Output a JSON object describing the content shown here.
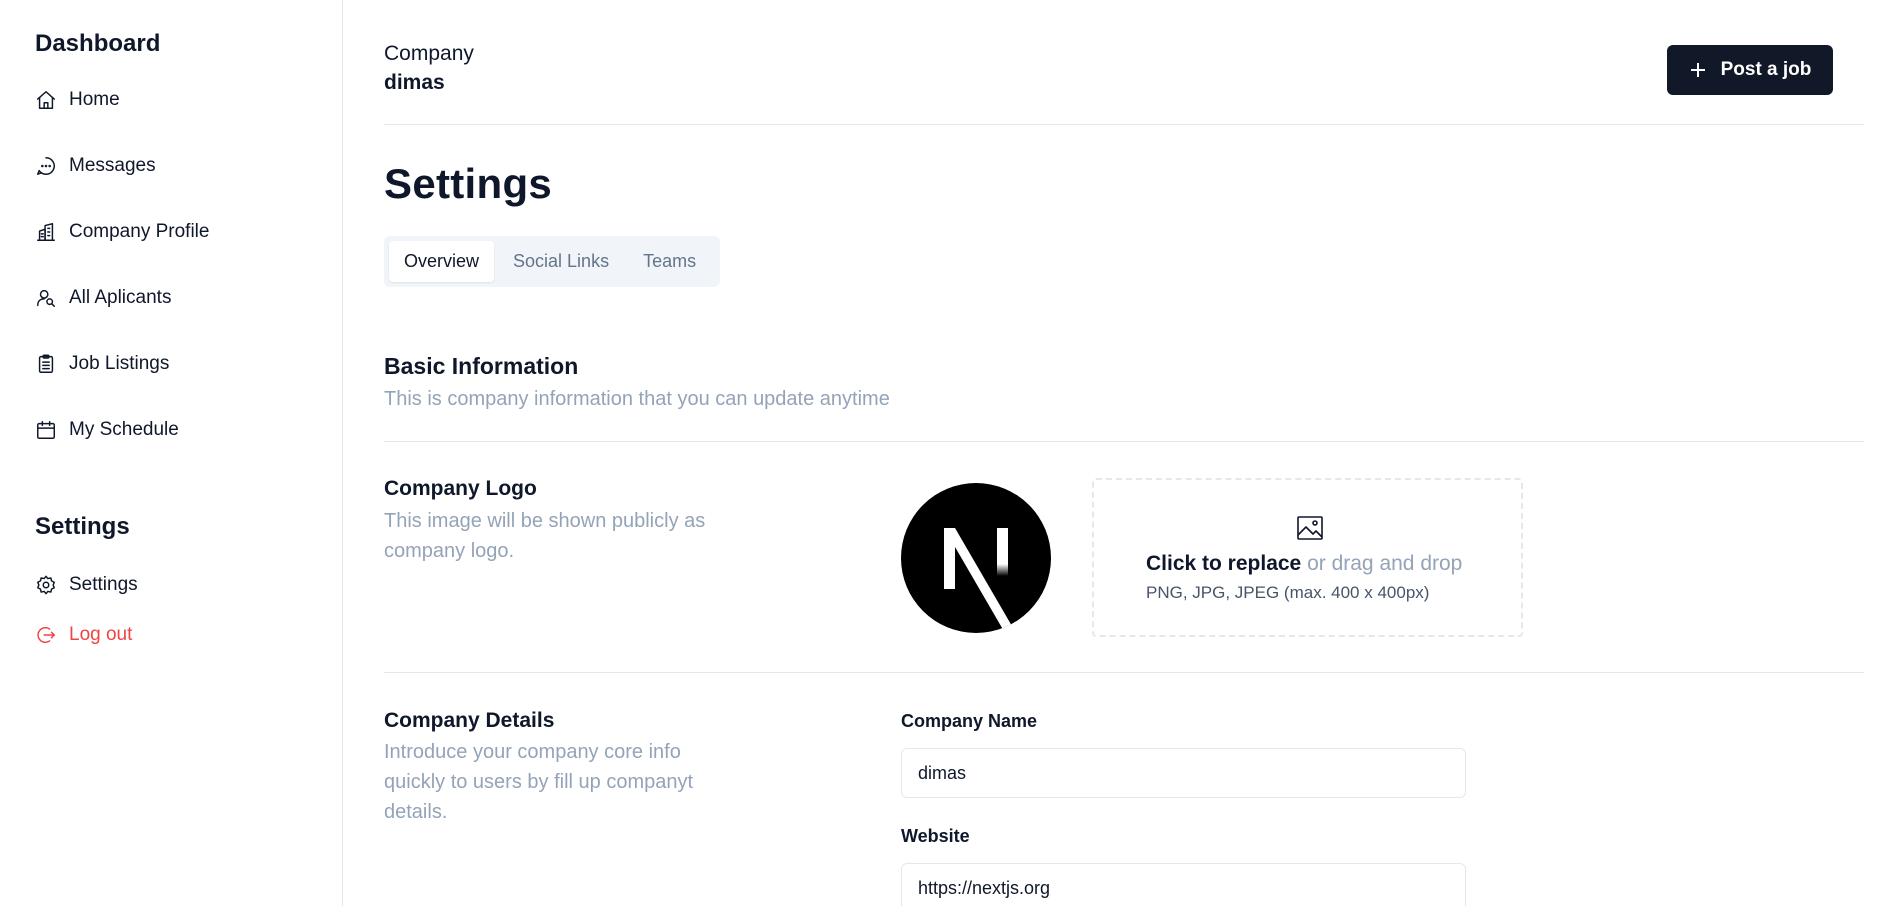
{
  "sidebar": {
    "dashboard_heading": "Dashboard",
    "items": [
      {
        "label": "Home",
        "icon": "home-icon"
      },
      {
        "label": "Messages",
        "icon": "chat-icon"
      },
      {
        "label": "Company Profile",
        "icon": "building-icon"
      },
      {
        "label": "All Aplicants",
        "icon": "users-icon"
      },
      {
        "label": "Job Listings",
        "icon": "clipboard-icon"
      },
      {
        "label": "My Schedule",
        "icon": "calendar-icon"
      }
    ],
    "settings_heading": "Settings",
    "settings_items": [
      {
        "label": "Settings",
        "icon": "gear-icon"
      },
      {
        "label": "Log out",
        "icon": "logout-icon"
      }
    ],
    "logout_color": "#ef4444"
  },
  "header": {
    "company_label": "Company",
    "company_name": "dimas",
    "post_job_label": "Post a job"
  },
  "page": {
    "title": "Settings",
    "tabs": [
      "Overview",
      "Social Links",
      "Teams"
    ],
    "active_tab": "Overview"
  },
  "basic_info": {
    "title": "Basic Information",
    "description": "This is company information that you can update anytime"
  },
  "company_logo": {
    "title": "Company Logo",
    "description_line1": "This image will be shown publicly as",
    "description_line2": "company logo.",
    "upload_action": "Click to replace",
    "upload_rest": " or drag and drop",
    "upload_hint": "PNG, JPG, JPEG (max. 400 x 400px)"
  },
  "company_details": {
    "title": "Company Details",
    "description_line1": "Introduce your company core info",
    "description_line2": "quickly to users by fill up companyt",
    "description_line3": "details.",
    "fields": [
      {
        "label": "Company Name",
        "value": "dimas"
      },
      {
        "label": "Website",
        "value": "https://nextjs.org"
      }
    ]
  },
  "colors": {
    "primary": "#111827",
    "muted_text": "#94a3b8",
    "border": "#e5e7eb",
    "danger": "#ef4444"
  }
}
